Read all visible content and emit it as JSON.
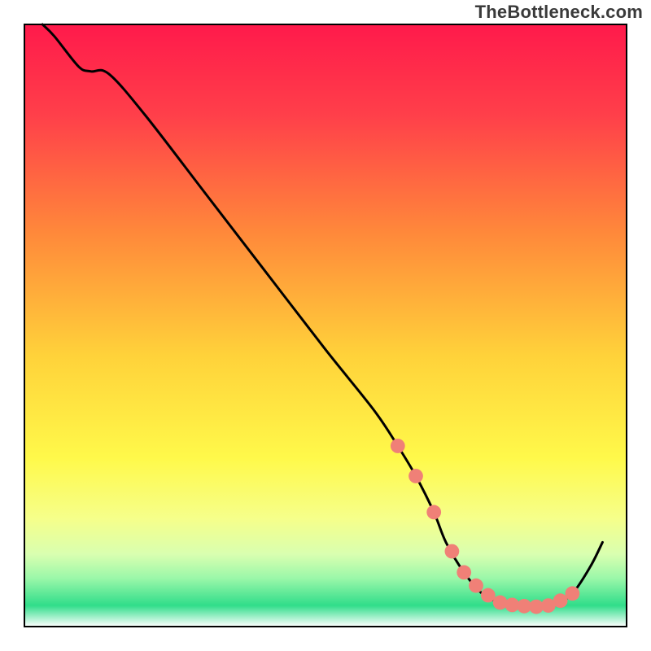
{
  "watermark": "TheBottleneck.com",
  "chart_data": {
    "type": "line",
    "title": "",
    "xlabel": "",
    "ylabel": "",
    "xlim": [
      0,
      100
    ],
    "ylim": [
      0,
      100
    ],
    "grid": false,
    "legend": false,
    "background_gradient_stops": [
      {
        "offset": 0.0,
        "color": "#ff1a4b"
      },
      {
        "offset": 0.15,
        "color": "#ff3f4a"
      },
      {
        "offset": 0.35,
        "color": "#ff8a3a"
      },
      {
        "offset": 0.55,
        "color": "#ffd23a"
      },
      {
        "offset": 0.72,
        "color": "#fff94a"
      },
      {
        "offset": 0.82,
        "color": "#f6ff8a"
      },
      {
        "offset": 0.88,
        "color": "#d9ffb0"
      },
      {
        "offset": 0.92,
        "color": "#9af7a9"
      },
      {
        "offset": 0.965,
        "color": "#30dd8a"
      },
      {
        "offset": 1.0,
        "color": "#ffffff"
      }
    ],
    "series": [
      {
        "name": "bottleneck-curve",
        "color": "#000000",
        "x": [
          3,
          5,
          9,
          11,
          14,
          20,
          30,
          40,
          50,
          58,
          62,
          65,
          68,
          70,
          73,
          76,
          79,
          82,
          85,
          88,
          91,
          94,
          96
        ],
        "y": [
          100,
          98,
          93,
          92.2,
          91.8,
          85,
          72,
          59,
          46,
          36,
          30,
          25,
          19,
          14,
          9,
          5.5,
          4,
          3.4,
          3.3,
          3.7,
          5.5,
          10,
          14
        ]
      }
    ],
    "markers": {
      "name": "highlighted-points",
      "color": "#f08077",
      "radius_fraction": 0.012,
      "x": [
        62,
        65,
        68,
        71,
        73,
        75,
        77,
        79,
        81,
        83,
        85,
        87,
        89,
        91
      ],
      "y": [
        30,
        25,
        19,
        12.5,
        9,
        6.8,
        5.2,
        4,
        3.6,
        3.4,
        3.3,
        3.5,
        4.3,
        5.5
      ]
    }
  }
}
